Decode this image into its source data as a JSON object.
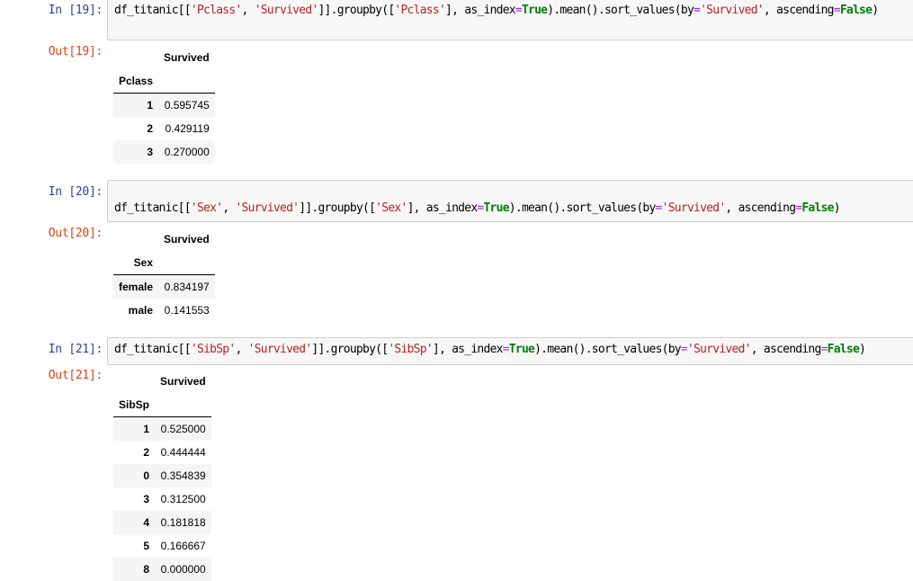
{
  "cells": [
    {
      "in_prompt": "In [19]:",
      "out_prompt": "Out[19]:",
      "code": {
        "p1": "df_titanic[[",
        "s1": "'Pclass'",
        "p2": ", ",
        "s2": "'Survived'",
        "p3": "]].groupby([",
        "s3": "'Pclass'",
        "p4": "], as_index",
        "eq1": "=",
        "true_kw": "True",
        "p5": ").mean().sort_values(by",
        "eq2": "=",
        "s4": "'Survived'",
        "p6": ", ascending",
        "eq3": "=",
        "false_kw": "False",
        "p7": ")"
      },
      "table": {
        "column": "Survived",
        "index_name": "Pclass",
        "rows": [
          {
            "index": "1",
            "value": "0.595745"
          },
          {
            "index": "2",
            "value": "0.429119"
          },
          {
            "index": "3",
            "value": "0.270000"
          }
        ]
      }
    },
    {
      "in_prompt": "In [20]:",
      "out_prompt": "Out[20]:",
      "code": {
        "p1": "df_titanic[[",
        "s1": "'Sex'",
        "p2": ", ",
        "s2": "'Survived'",
        "p3": "]].groupby([",
        "s3": "'Sex'",
        "p4": "], as_index",
        "eq1": "=",
        "true_kw": "True",
        "p5": ").mean().sort_values(by",
        "eq2": "=",
        "s4": "'Survived'",
        "p6": ", ascending",
        "eq3": "=",
        "false_kw": "False",
        "p7": ")"
      },
      "table": {
        "column": "Survived",
        "index_name": "Sex",
        "rows": [
          {
            "index": "female",
            "value": "0.834197"
          },
          {
            "index": "male",
            "value": "0.141553"
          }
        ]
      }
    },
    {
      "in_prompt": "In [21]:",
      "out_prompt": "Out[21]:",
      "code": {
        "p1": "df_titanic[[",
        "s1": "'SibSp'",
        "p2": ", ",
        "s2": "'Survived'",
        "p3": "]].groupby([",
        "s3": "'SibSp'",
        "p4": "], as_index",
        "eq1": "=",
        "true_kw": "True",
        "p5": ").mean().sort_values(by",
        "eq2": "=",
        "s4": "'Survived'",
        "p6": ", ascending",
        "eq3": "=",
        "false_kw": "False",
        "p7": ")"
      },
      "table": {
        "column": "Survived",
        "index_name": "SibSp",
        "rows": [
          {
            "index": "1",
            "value": "0.525000"
          },
          {
            "index": "2",
            "value": "0.444444"
          },
          {
            "index": "0",
            "value": "0.354839"
          },
          {
            "index": "3",
            "value": "0.312500"
          },
          {
            "index": "4",
            "value": "0.181818"
          },
          {
            "index": "5",
            "value": "0.166667"
          },
          {
            "index": "8",
            "value": "0.000000"
          }
        ]
      }
    }
  ],
  "colors": {
    "in_prompt": "#303f9f",
    "out_prompt": "#d84315",
    "string": "#ba2121",
    "keyword": "#008000",
    "operator": "#aa22ff",
    "input_bg": "#f7f7f7",
    "stripe_bg": "#f5f5f5"
  }
}
